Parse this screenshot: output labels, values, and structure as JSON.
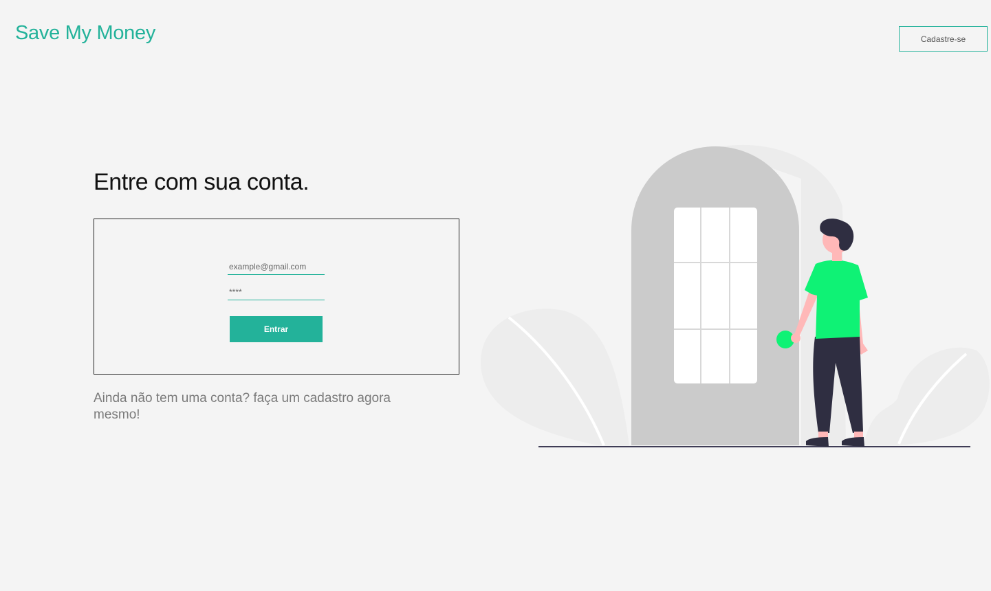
{
  "header": {
    "brand": "Save My Money",
    "signup_label": "Cadastre-se"
  },
  "login": {
    "title": "Entre com sua conta.",
    "email_placeholder": "example@gmail.com",
    "password_placeholder": "****",
    "submit_label": "Entrar"
  },
  "footer": {
    "signup_prompt": "Ainda não tem uma conta? faça um cadastro agora mesmo!"
  },
  "illustration": {
    "icon": "person-at-door-illustration"
  },
  "colors": {
    "accent": "#23b29a",
    "background": "#f4f4f4",
    "shirt": "#0ff275",
    "door": "#cbcbcb",
    "dark": "#2f2e41"
  }
}
